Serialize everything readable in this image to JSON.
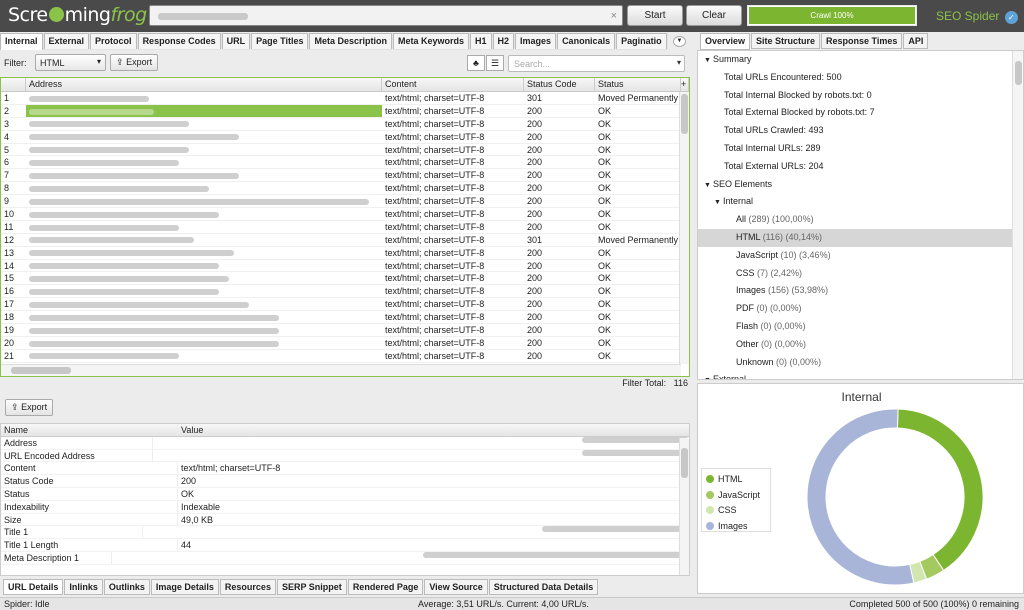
{
  "app": {
    "logo_main": "Scre",
    "logo_mid": "ming",
    "logo_frog": "frog",
    "brand": "SEO Spider",
    "brand_badge": "✓"
  },
  "top": {
    "start_label": "Start",
    "clear_label": "Clear",
    "crawl_label": "Crawl 100%",
    "crawl_progress": 1.0,
    "url_clear_icon": "×"
  },
  "left_tabs": [
    "Internal",
    "External",
    "Protocol",
    "Response Codes",
    "URL",
    "Page Titles",
    "Meta Description",
    "Meta Keywords",
    "H1",
    "H2",
    "Images",
    "Canonicals",
    "Paginatio"
  ],
  "toolbar": {
    "filter_label": "Filter:",
    "filter_value": "HTML",
    "export_label": "Export",
    "search_placeholder": "Search..."
  },
  "grid": {
    "columns": [
      "",
      "Address",
      "Content",
      "Status Code",
      "Status"
    ],
    "rows": [
      {
        "n": "1",
        "content": "text/html; charset=UTF-8",
        "code": "301",
        "status": "Moved Permanently"
      },
      {
        "n": "2",
        "content": "text/html; charset=UTF-8",
        "code": "200",
        "status": "OK"
      },
      {
        "n": "3",
        "content": "text/html; charset=UTF-8",
        "code": "200",
        "status": "OK"
      },
      {
        "n": "4",
        "content": "text/html; charset=UTF-8",
        "code": "200",
        "status": "OK"
      },
      {
        "n": "5",
        "content": "text/html; charset=UTF-8",
        "code": "200",
        "status": "OK"
      },
      {
        "n": "6",
        "content": "text/html; charset=UTF-8",
        "code": "200",
        "status": "OK"
      },
      {
        "n": "7",
        "content": "text/html; charset=UTF-8",
        "code": "200",
        "status": "OK"
      },
      {
        "n": "8",
        "content": "text/html; charset=UTF-8",
        "code": "200",
        "status": "OK"
      },
      {
        "n": "9",
        "content": "text/html; charset=UTF-8",
        "code": "200",
        "status": "OK"
      },
      {
        "n": "10",
        "content": "text/html; charset=UTF-8",
        "code": "200",
        "status": "OK"
      },
      {
        "n": "11",
        "content": "text/html; charset=UTF-8",
        "code": "200",
        "status": "OK"
      },
      {
        "n": "12",
        "content": "text/html; charset=UTF-8",
        "code": "301",
        "status": "Moved Permanently"
      },
      {
        "n": "13",
        "content": "text/html; charset=UTF-8",
        "code": "200",
        "status": "OK"
      },
      {
        "n": "14",
        "content": "text/html; charset=UTF-8",
        "code": "200",
        "status": "OK"
      },
      {
        "n": "15",
        "content": "text/html; charset=UTF-8",
        "code": "200",
        "status": "OK"
      },
      {
        "n": "16",
        "content": "text/html; charset=UTF-8",
        "code": "200",
        "status": "OK"
      },
      {
        "n": "17",
        "content": "text/html; charset=UTF-8",
        "code": "200",
        "status": "OK"
      },
      {
        "n": "18",
        "content": "text/html; charset=UTF-8",
        "code": "200",
        "status": "OK"
      },
      {
        "n": "19",
        "content": "text/html; charset=UTF-8",
        "code": "200",
        "status": "OK"
      },
      {
        "n": "20",
        "content": "text/html; charset=UTF-8",
        "code": "200",
        "status": "OK"
      },
      {
        "n": "21",
        "content": "text/html; charset=UTF-8",
        "code": "200",
        "status": "OK"
      }
    ],
    "selected_row": 1
  },
  "filter_total": {
    "label": "Filter Total:",
    "value": "116"
  },
  "details": {
    "export_label": "Export",
    "head": [
      "Name",
      "Value"
    ],
    "rows": [
      {
        "name": "Address",
        "value": ""
      },
      {
        "name": "URL Encoded Address",
        "value": ""
      },
      {
        "name": "Content",
        "value": "text/html; charset=UTF-8"
      },
      {
        "name": "Status Code",
        "value": "200"
      },
      {
        "name": "Status",
        "value": "OK"
      },
      {
        "name": "Indexability",
        "value": "Indexable"
      },
      {
        "name": "Size",
        "value": "49,0 KB"
      },
      {
        "name": "Title 1",
        "value": ""
      },
      {
        "name": "Title 1 Length",
        "value": "44"
      },
      {
        "name": "Meta Description 1",
        "value": ""
      }
    ]
  },
  "bottom_tabs": [
    "URL Details",
    "Inlinks",
    "Outlinks",
    "Image Details",
    "Resources",
    "SERP Snippet",
    "Rendered Page",
    "View Source",
    "Structured Data Details"
  ],
  "right_tabs": [
    "Overview",
    "Site Structure",
    "Response Times",
    "API"
  ],
  "tree": [
    {
      "label": "Summary",
      "level": 0,
      "tri": "▼"
    },
    {
      "label": "Total URLs Encountered: 500",
      "level": 1
    },
    {
      "label": "Total Internal Blocked by robots.txt: 0",
      "level": 1
    },
    {
      "label": "Total External Blocked by robots.txt: 7",
      "level": 1
    },
    {
      "label": "Total URLs Crawled: 493",
      "level": 1
    },
    {
      "label": "Total Internal URLs: 289",
      "level": 1
    },
    {
      "label": "Total External URLs: 204",
      "level": 1
    },
    {
      "label": "SEO Elements",
      "level": 0,
      "tri": "▼"
    },
    {
      "label": "Internal",
      "level": 1,
      "tri": "▼"
    },
    {
      "label": "All",
      "count": "(289) (100,00%)",
      "level": 2
    },
    {
      "label": "HTML",
      "count": "(116) (40,14%)",
      "level": 2,
      "hl": true
    },
    {
      "label": "JavaScript",
      "count": "(10) (3,46%)",
      "level": 2
    },
    {
      "label": "CSS",
      "count": "(7) (2,42%)",
      "level": 2
    },
    {
      "label": "Images",
      "count": "(156) (53,98%)",
      "level": 2
    },
    {
      "label": "PDF",
      "count": "(0) (0,00%)",
      "level": 2
    },
    {
      "label": "Flash",
      "count": "(0) (0,00%)",
      "level": 2
    },
    {
      "label": "Other",
      "count": "(0) (0,00%)",
      "level": 2
    },
    {
      "label": "Unknown",
      "count": "(0) (0,00%)",
      "level": 2
    },
    {
      "label": "External",
      "level": 0,
      "tri": "▼"
    }
  ],
  "chart_data": {
    "type": "pie",
    "title": "Internal",
    "categories": [
      "HTML",
      "JavaScript",
      "CSS",
      "Images"
    ],
    "values": [
      116,
      10,
      7,
      156
    ],
    "colors": [
      "#7cb52f",
      "#a3c95f",
      "#d2e6b0",
      "#a8b5d8"
    ],
    "legend": "left",
    "donut": true
  },
  "status": {
    "spider": "Spider: Idle",
    "average": "Average: 3,51 URL/s. Current: 4,00 URL/s.",
    "completed": "Completed 500 of 500 (100%) 0 remaining"
  }
}
